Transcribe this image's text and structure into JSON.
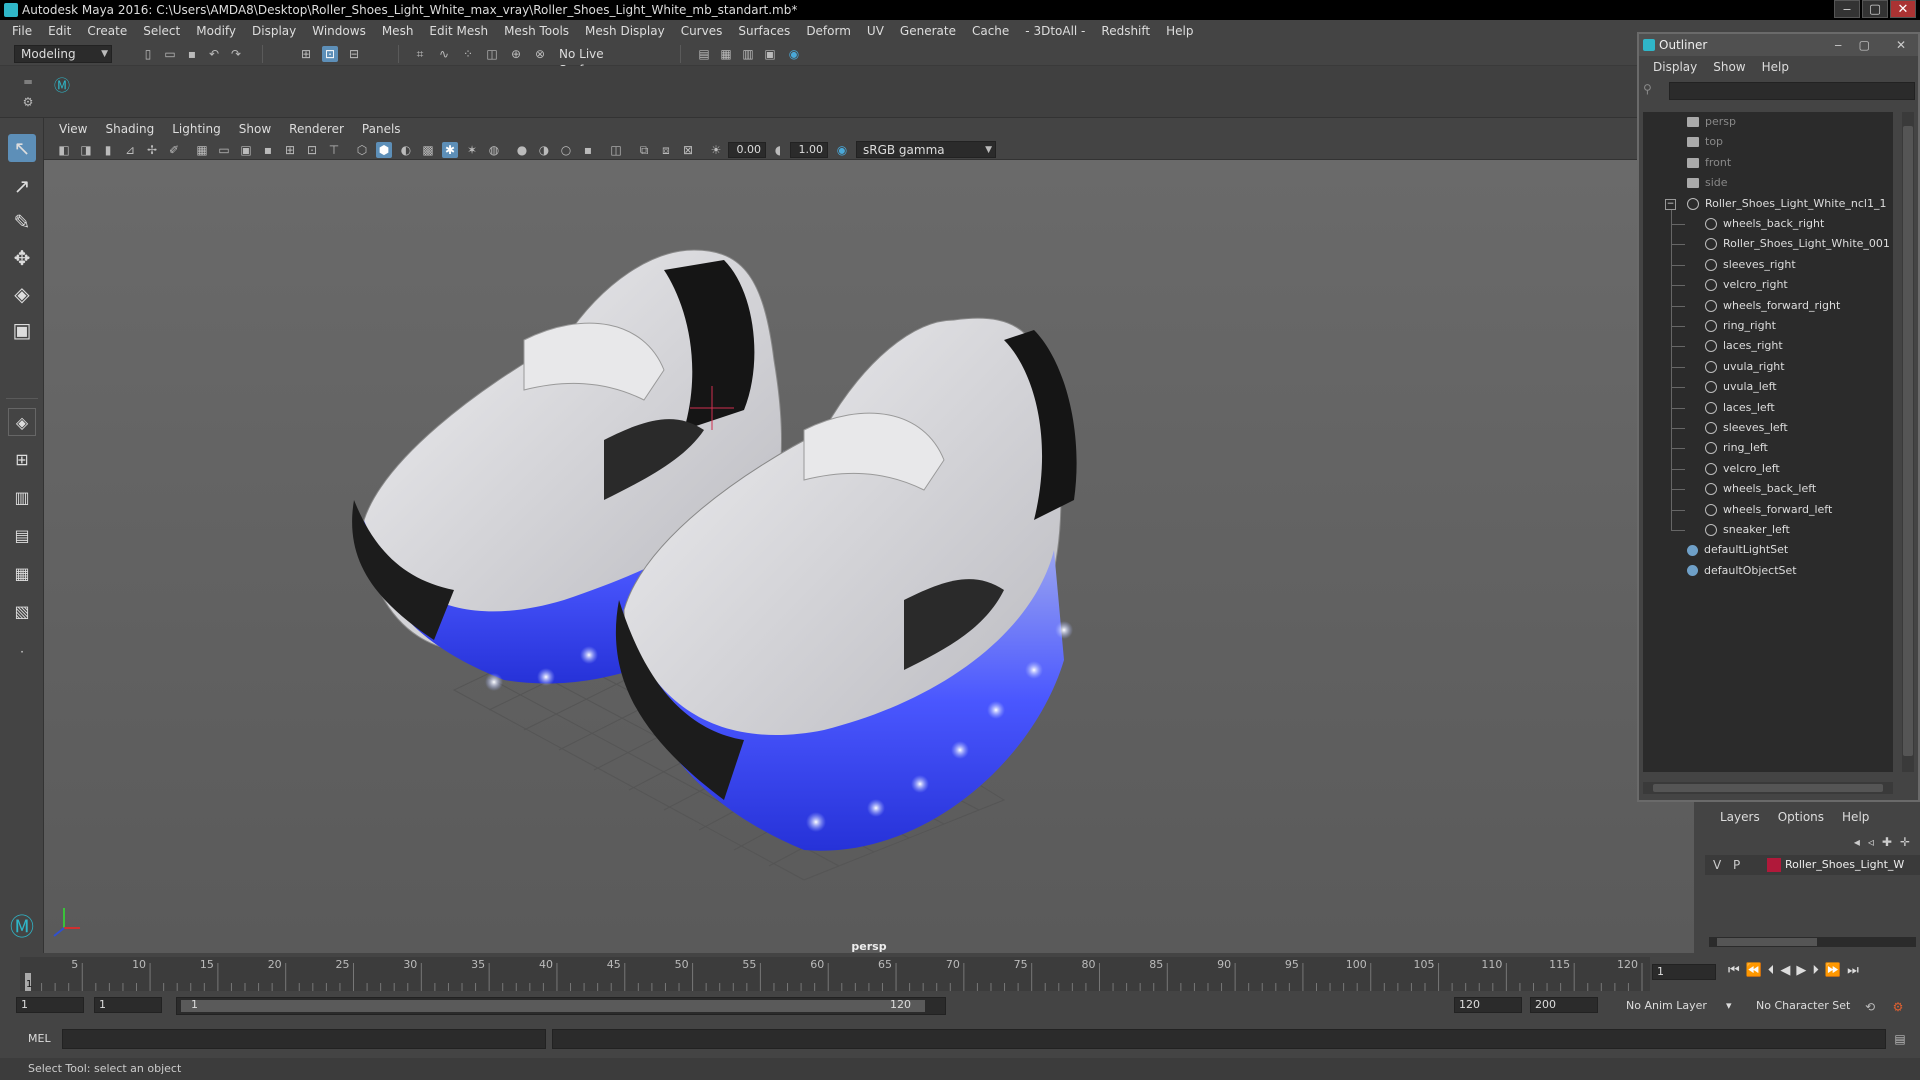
{
  "window": {
    "title": "Autodesk Maya 2016: C:\\Users\\AMDA8\\Desktop\\Roller_Shoes_Light_White_max_vray\\Roller_Shoes_Light_White_mb_standart.mb*",
    "minimize": "‒",
    "maximize": "▢",
    "close": "✕"
  },
  "menubar": [
    "File",
    "Edit",
    "Create",
    "Select",
    "Modify",
    "Display",
    "Windows",
    "Mesh",
    "Edit Mesh",
    "Mesh Tools",
    "Mesh Display",
    "Curves",
    "Surfaces",
    "Deform",
    "UV",
    "Generate",
    "Cache",
    "- 3DtoAll -",
    "Redshift",
    "Help"
  ],
  "toolbar": {
    "mode": "Modeling",
    "live_surface": "No Live Surface"
  },
  "viewport": {
    "menu": [
      "View",
      "Shading",
      "Lighting",
      "Show",
      "Renderer",
      "Panels"
    ],
    "exposure": "0.00",
    "gamma": "1.00",
    "color_space": "sRGB gamma",
    "camera_label": "persp"
  },
  "outliner": {
    "title": "Outliner",
    "menu": [
      "Display",
      "Show",
      "Help"
    ],
    "cameras": [
      "persp",
      "top",
      "front",
      "side"
    ],
    "group": "Roller_Shoes_Light_White_ncl1_1",
    "children": [
      "wheels_back_right",
      "Roller_Shoes_Light_White_001",
      "sleeves_right",
      "velcro_right",
      "wheels_forward_right",
      "ring_right",
      "laces_right",
      "uvula_right",
      "uvula_left",
      "laces_left",
      "sleeves_left",
      "ring_left",
      "velcro_left",
      "wheels_back_left",
      "wheels_forward_left",
      "sneaker_left"
    ],
    "sets": [
      "defaultLightSet",
      "defaultObjectSet"
    ]
  },
  "layers": {
    "menu": [
      "Layers",
      "Options",
      "Help"
    ],
    "row": {
      "v": "V",
      "p": "P",
      "name": "Roller_Shoes_Light_W",
      "color": "#b0193a"
    }
  },
  "timeline": {
    "ticks": [
      5,
      10,
      15,
      20,
      25,
      30,
      35,
      40,
      45,
      50,
      55,
      60,
      65,
      70,
      75,
      80,
      85,
      90,
      95,
      100,
      105,
      110,
      115,
      120
    ],
    "current_frame_marker": "1",
    "current_frame": "1"
  },
  "range": {
    "start": "1",
    "inner_start": "1",
    "slider_start": "1",
    "slider_end": "120",
    "end": "120",
    "outer_end": "200",
    "anim_layer": "No Anim Layer",
    "character_set": "No Character Set"
  },
  "cmdline": {
    "label": "MEL"
  },
  "helpline": {
    "text": "Select Tool: select an object"
  },
  "colors": {
    "accent": "#5a6cff",
    "shoe": "#d9d9de",
    "sole_glow": "#4a57ff"
  }
}
